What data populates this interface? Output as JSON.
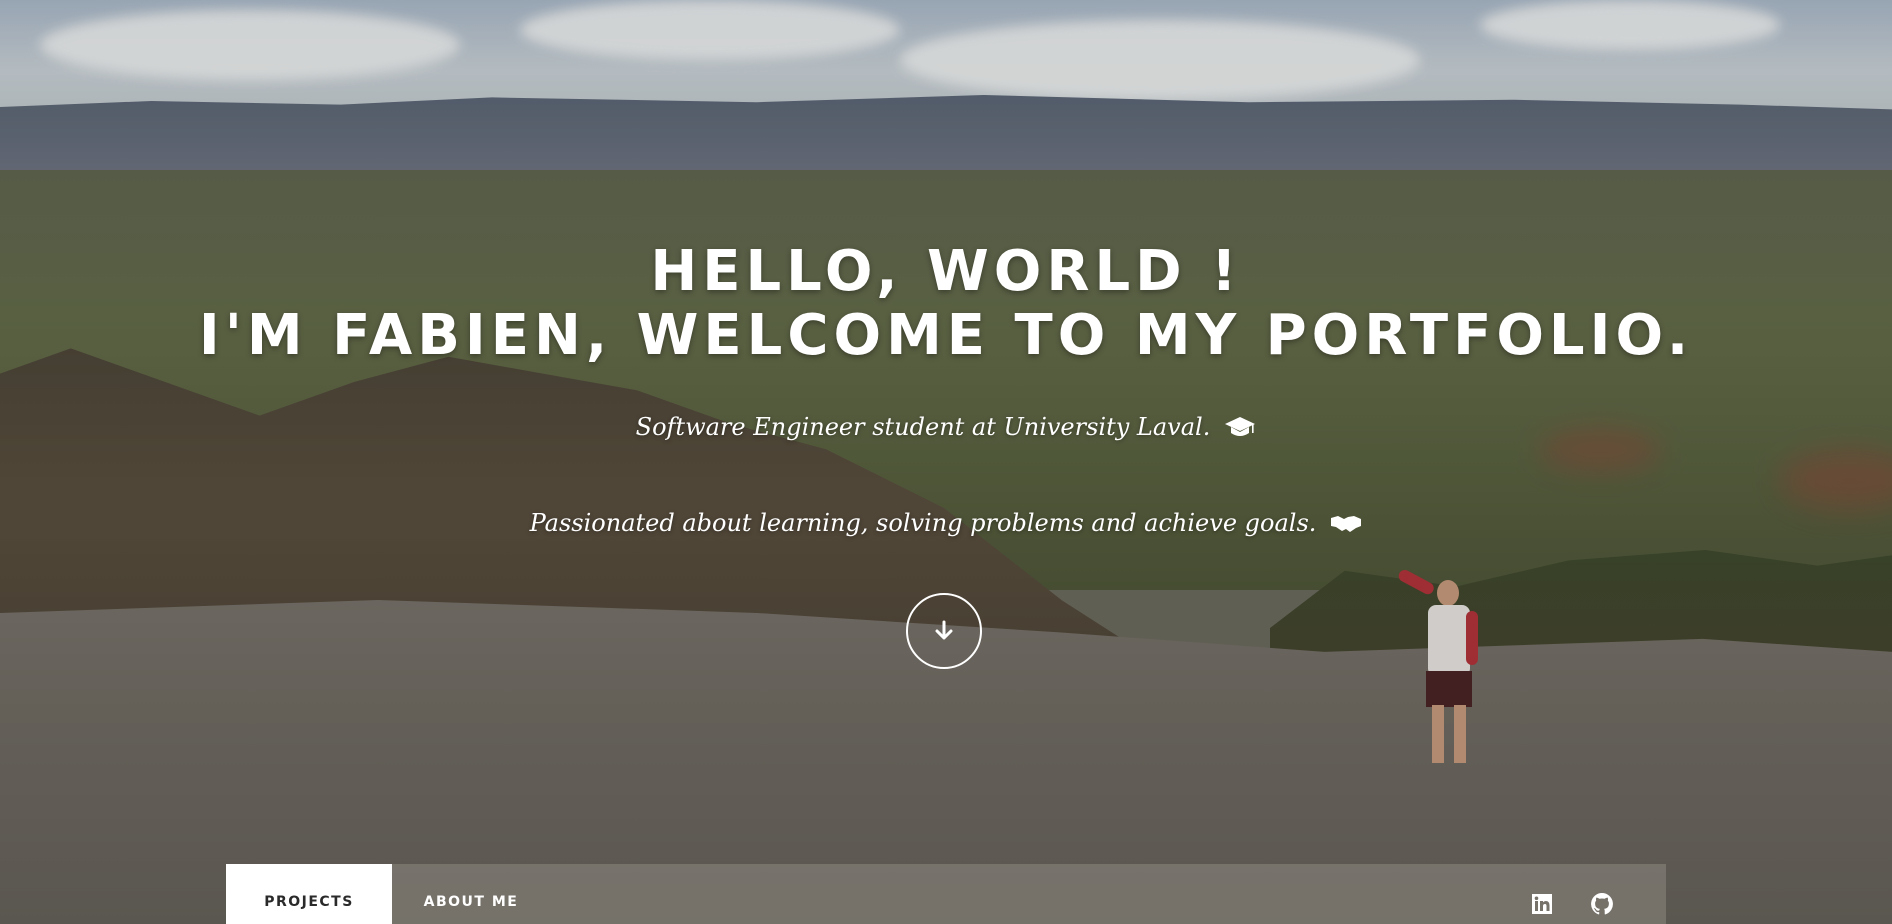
{
  "hero": {
    "title_line1": "HELLO, WORLD !",
    "title_line2": "I'M FABIEN, WELCOME TO MY PORTFOLIO.",
    "tagline1": "Software Engineer student at University Laval.",
    "tagline1_icon": "graduation-cap-icon",
    "tagline2": "Passionated about learning, solving problems and achieve goals.",
    "tagline2_icon": "handshake-icon",
    "scroll_icon": "arrow-down-icon"
  },
  "nav": {
    "tabs": [
      {
        "label": "PROJECTS",
        "active": true
      },
      {
        "label": "ABOUT ME",
        "active": false
      }
    ],
    "social": [
      "linkedin-icon",
      "github-icon"
    ]
  },
  "colors": {
    "text": "#ffffff",
    "active_tab_bg": "#ffffff",
    "active_tab_text": "#2a2a2a"
  }
}
